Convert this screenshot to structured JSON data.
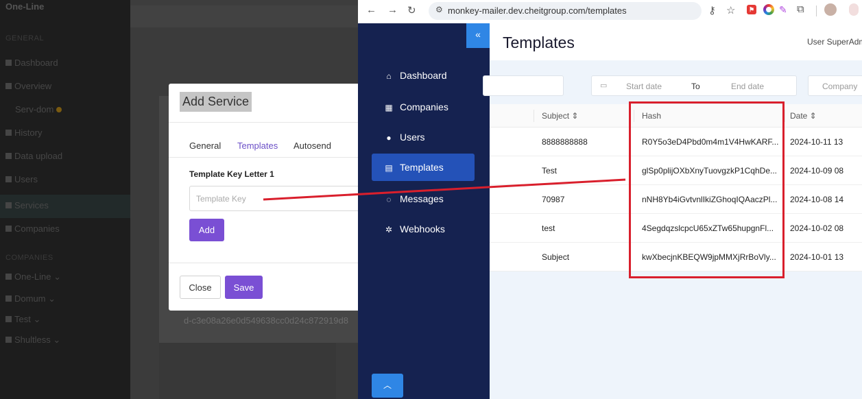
{
  "left_app": {
    "brand": "One-Line",
    "section_general": "GENERAL",
    "section_companies": "COMPANIES",
    "items": [
      "Dashboard",
      "Overview",
      "Serv-dom",
      "History",
      "Data upload",
      "Users",
      "Services",
      "Companies"
    ],
    "company_items": [
      "One-Line",
      "Domum",
      "Test",
      "Shultless"
    ],
    "background_hash": "d-c3e08a26e0d549638cc0d24c872919d8"
  },
  "modal": {
    "title": "Add Service",
    "tabs": [
      "General",
      "Templates",
      "Autosend"
    ],
    "field_label": "Template Key Letter 1",
    "field_placeholder": "Template Key",
    "field_value": "",
    "add_label": "Add",
    "close_label": "Close",
    "save_label": "Save"
  },
  "browser": {
    "url": "monkey-mailer.dev.cheitgroup.com/templates"
  },
  "app": {
    "collapse_glyph": "«",
    "nav": [
      {
        "label": "Dashboard",
        "icon": "home-icon"
      },
      {
        "label": "Companies",
        "icon": "building-icon"
      },
      {
        "label": "Users",
        "icon": "user-icon"
      },
      {
        "label": "Templates",
        "icon": "document-icon",
        "active": true
      },
      {
        "label": "Messages",
        "icon": "chat-icon"
      },
      {
        "label": "Webhooks",
        "icon": "webhook-icon"
      }
    ],
    "page_title": "Templates",
    "user_label": "User SuperAdmin",
    "filters": {
      "start_placeholder": "Start date",
      "to_label": "To",
      "end_placeholder": "End date",
      "company_placeholder": "Company"
    },
    "table": {
      "headers": {
        "subject": "Subject ⇕",
        "hash": "Hash",
        "date": "Date ⇕"
      },
      "rows": [
        {
          "subject": "8888888888",
          "hash": "R0Y5o3eD4Pbd0m4m1V4HwKARF...",
          "date": "2024-10-11 13"
        },
        {
          "subject": "Test",
          "hash": "glSp0plijOXbXnyTuovgzkP1CqhDe...",
          "date": "2024-10-09 08"
        },
        {
          "subject": "70987",
          "hash": "nNH8Yb4iGvtvnlIkiZGhoqIQAaczPl...",
          "date": "2024-10-08 14"
        },
        {
          "subject": "test",
          "hash": "4SegdqzslcpcU65xZTw65hupgnFl...",
          "date": "2024-10-02 08"
        },
        {
          "subject": "Subject",
          "hash": "kwXbecjnKBEQW9jpMMXjRrBoVly...",
          "date": "2024-10-01 13"
        }
      ]
    }
  },
  "colors": {
    "accent_purple": "#7a4fd4",
    "sidebar_navy": "#152250",
    "nav_active": "#2452b8",
    "annotation_red": "#d91f2c"
  }
}
